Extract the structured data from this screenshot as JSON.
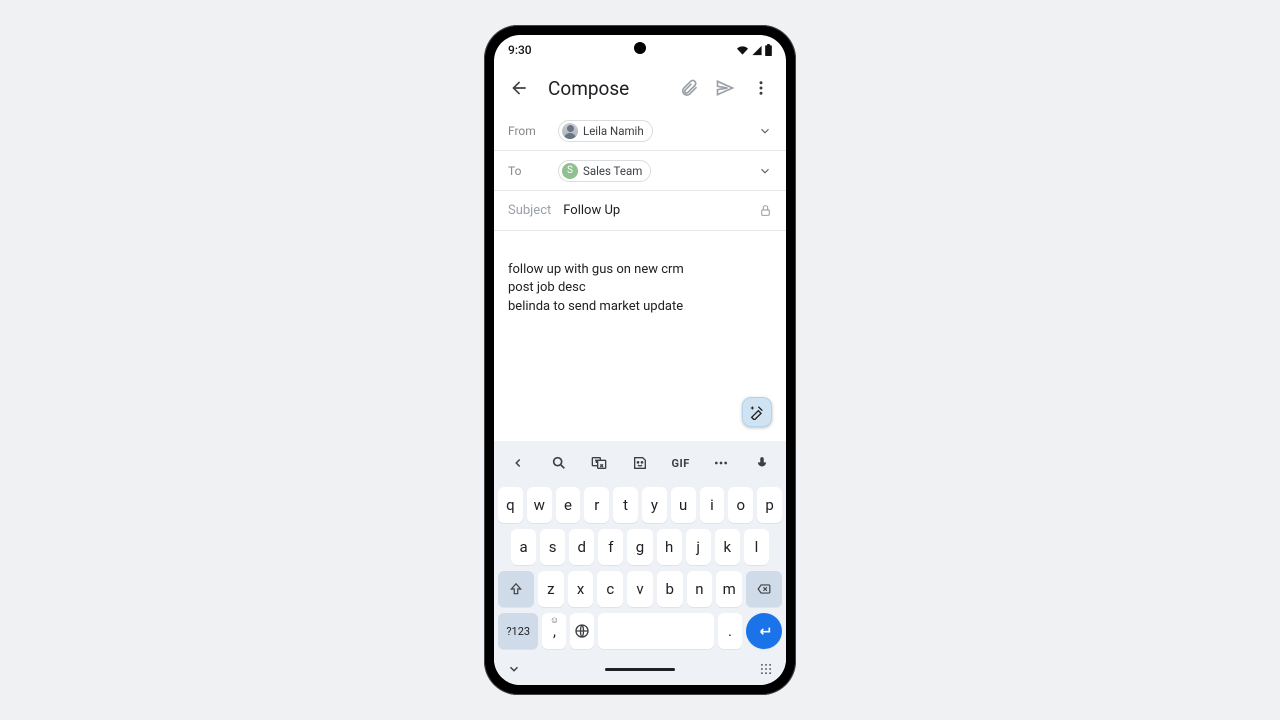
{
  "status": {
    "time": "9:30"
  },
  "header": {
    "title": "Compose"
  },
  "from": {
    "label": "From",
    "name": "Leila Namih"
  },
  "to": {
    "label": "To",
    "name": "Sales Team",
    "initial": "S"
  },
  "subject": {
    "label": "Subject",
    "value": "Follow Up"
  },
  "body": "follow up with gus on new crm\npost job desc\nbelinda to send market update",
  "keyboard": {
    "toolbar_gif": "GIF",
    "row1": [
      "q",
      "w",
      "e",
      "r",
      "t",
      "y",
      "u",
      "i",
      "o",
      "p"
    ],
    "row2": [
      "a",
      "s",
      "d",
      "f",
      "g",
      "h",
      "j",
      "k",
      "l"
    ],
    "row3": [
      "z",
      "x",
      "c",
      "v",
      "b",
      "n",
      "m"
    ],
    "sym": "?123",
    "comma": ",",
    "period": "."
  }
}
